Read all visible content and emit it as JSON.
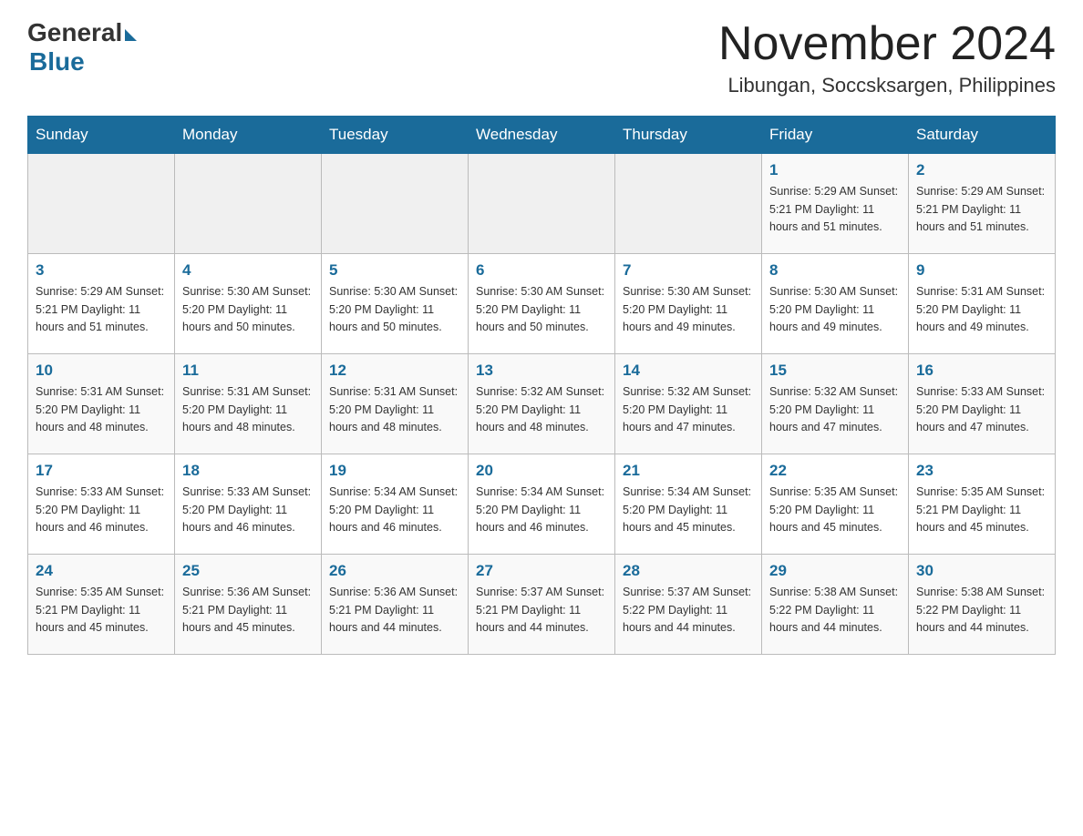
{
  "header": {
    "logo_general": "General",
    "logo_blue": "Blue",
    "month_title": "November 2024",
    "location": "Libungan, Soccsksargen, Philippines"
  },
  "days_of_week": [
    "Sunday",
    "Monday",
    "Tuesday",
    "Wednesday",
    "Thursday",
    "Friday",
    "Saturday"
  ],
  "weeks": [
    [
      {
        "day": "",
        "info": ""
      },
      {
        "day": "",
        "info": ""
      },
      {
        "day": "",
        "info": ""
      },
      {
        "day": "",
        "info": ""
      },
      {
        "day": "",
        "info": ""
      },
      {
        "day": "1",
        "info": "Sunrise: 5:29 AM\nSunset: 5:21 PM\nDaylight: 11 hours\nand 51 minutes."
      },
      {
        "day": "2",
        "info": "Sunrise: 5:29 AM\nSunset: 5:21 PM\nDaylight: 11 hours\nand 51 minutes."
      }
    ],
    [
      {
        "day": "3",
        "info": "Sunrise: 5:29 AM\nSunset: 5:21 PM\nDaylight: 11 hours\nand 51 minutes."
      },
      {
        "day": "4",
        "info": "Sunrise: 5:30 AM\nSunset: 5:20 PM\nDaylight: 11 hours\nand 50 minutes."
      },
      {
        "day": "5",
        "info": "Sunrise: 5:30 AM\nSunset: 5:20 PM\nDaylight: 11 hours\nand 50 minutes."
      },
      {
        "day": "6",
        "info": "Sunrise: 5:30 AM\nSunset: 5:20 PM\nDaylight: 11 hours\nand 50 minutes."
      },
      {
        "day": "7",
        "info": "Sunrise: 5:30 AM\nSunset: 5:20 PM\nDaylight: 11 hours\nand 49 minutes."
      },
      {
        "day": "8",
        "info": "Sunrise: 5:30 AM\nSunset: 5:20 PM\nDaylight: 11 hours\nand 49 minutes."
      },
      {
        "day": "9",
        "info": "Sunrise: 5:31 AM\nSunset: 5:20 PM\nDaylight: 11 hours\nand 49 minutes."
      }
    ],
    [
      {
        "day": "10",
        "info": "Sunrise: 5:31 AM\nSunset: 5:20 PM\nDaylight: 11 hours\nand 48 minutes."
      },
      {
        "day": "11",
        "info": "Sunrise: 5:31 AM\nSunset: 5:20 PM\nDaylight: 11 hours\nand 48 minutes."
      },
      {
        "day": "12",
        "info": "Sunrise: 5:31 AM\nSunset: 5:20 PM\nDaylight: 11 hours\nand 48 minutes."
      },
      {
        "day": "13",
        "info": "Sunrise: 5:32 AM\nSunset: 5:20 PM\nDaylight: 11 hours\nand 48 minutes."
      },
      {
        "day": "14",
        "info": "Sunrise: 5:32 AM\nSunset: 5:20 PM\nDaylight: 11 hours\nand 47 minutes."
      },
      {
        "day": "15",
        "info": "Sunrise: 5:32 AM\nSunset: 5:20 PM\nDaylight: 11 hours\nand 47 minutes."
      },
      {
        "day": "16",
        "info": "Sunrise: 5:33 AM\nSunset: 5:20 PM\nDaylight: 11 hours\nand 47 minutes."
      }
    ],
    [
      {
        "day": "17",
        "info": "Sunrise: 5:33 AM\nSunset: 5:20 PM\nDaylight: 11 hours\nand 46 minutes."
      },
      {
        "day": "18",
        "info": "Sunrise: 5:33 AM\nSunset: 5:20 PM\nDaylight: 11 hours\nand 46 minutes."
      },
      {
        "day": "19",
        "info": "Sunrise: 5:34 AM\nSunset: 5:20 PM\nDaylight: 11 hours\nand 46 minutes."
      },
      {
        "day": "20",
        "info": "Sunrise: 5:34 AM\nSunset: 5:20 PM\nDaylight: 11 hours\nand 46 minutes."
      },
      {
        "day": "21",
        "info": "Sunrise: 5:34 AM\nSunset: 5:20 PM\nDaylight: 11 hours\nand 45 minutes."
      },
      {
        "day": "22",
        "info": "Sunrise: 5:35 AM\nSunset: 5:20 PM\nDaylight: 11 hours\nand 45 minutes."
      },
      {
        "day": "23",
        "info": "Sunrise: 5:35 AM\nSunset: 5:21 PM\nDaylight: 11 hours\nand 45 minutes."
      }
    ],
    [
      {
        "day": "24",
        "info": "Sunrise: 5:35 AM\nSunset: 5:21 PM\nDaylight: 11 hours\nand 45 minutes."
      },
      {
        "day": "25",
        "info": "Sunrise: 5:36 AM\nSunset: 5:21 PM\nDaylight: 11 hours\nand 45 minutes."
      },
      {
        "day": "26",
        "info": "Sunrise: 5:36 AM\nSunset: 5:21 PM\nDaylight: 11 hours\nand 44 minutes."
      },
      {
        "day": "27",
        "info": "Sunrise: 5:37 AM\nSunset: 5:21 PM\nDaylight: 11 hours\nand 44 minutes."
      },
      {
        "day": "28",
        "info": "Sunrise: 5:37 AM\nSunset: 5:22 PM\nDaylight: 11 hours\nand 44 minutes."
      },
      {
        "day": "29",
        "info": "Sunrise: 5:38 AM\nSunset: 5:22 PM\nDaylight: 11 hours\nand 44 minutes."
      },
      {
        "day": "30",
        "info": "Sunrise: 5:38 AM\nSunset: 5:22 PM\nDaylight: 11 hours\nand 44 minutes."
      }
    ]
  ]
}
